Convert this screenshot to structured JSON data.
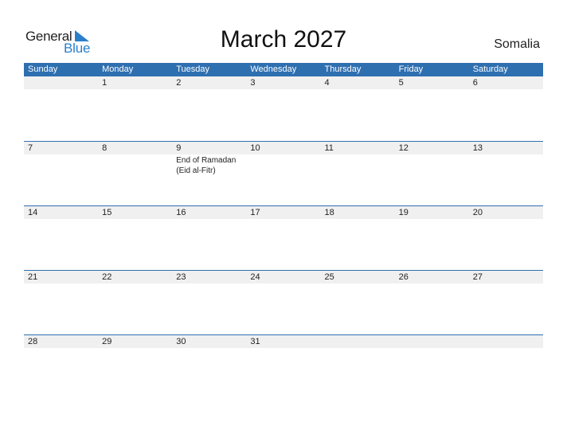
{
  "logo": {
    "line1": "General",
    "line2": "Blue",
    "accent": "#2a7fc9"
  },
  "title": "March 2027",
  "country": "Somalia",
  "colors": {
    "header_bg": "#2e6fb0",
    "day_row_bg": "#f0f0f0"
  },
  "weekdays": [
    "Sunday",
    "Monday",
    "Tuesday",
    "Wednesday",
    "Thursday",
    "Friday",
    "Saturday"
  ],
  "weeks": [
    {
      "days": [
        "",
        "1",
        "2",
        "3",
        "4",
        "5",
        "6"
      ],
      "events": [
        "",
        "",
        "",
        "",
        "",
        "",
        ""
      ]
    },
    {
      "days": [
        "7",
        "8",
        "9",
        "10",
        "11",
        "12",
        "13"
      ],
      "events": [
        "",
        "",
        "End of Ramadan (Eid al-Fitr)",
        "",
        "",
        "",
        ""
      ]
    },
    {
      "days": [
        "14",
        "15",
        "16",
        "17",
        "18",
        "19",
        "20"
      ],
      "events": [
        "",
        "",
        "",
        "",
        "",
        "",
        ""
      ]
    },
    {
      "days": [
        "21",
        "22",
        "23",
        "24",
        "25",
        "26",
        "27"
      ],
      "events": [
        "",
        "",
        "",
        "",
        "",
        "",
        ""
      ]
    },
    {
      "days": [
        "28",
        "29",
        "30",
        "31",
        "",
        "",
        ""
      ],
      "events": [
        "",
        "",
        "",
        "",
        "",
        "",
        ""
      ]
    }
  ]
}
